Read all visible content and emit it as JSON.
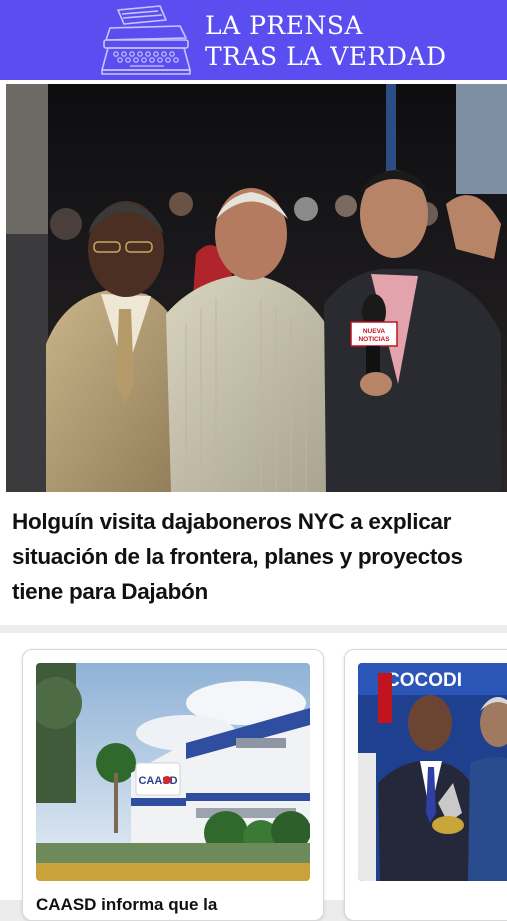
{
  "header": {
    "title_line1": "LA PRENSA",
    "title_line2": "TRAS LA VERDAD",
    "logo_icon": "typewriter-icon",
    "background": "#5a4ef0"
  },
  "hero": {
    "headline": "Holguín visita dajaboneros NYC a explicar situación de la frontera, planes y proyectos tiene para Dajabón",
    "mic_label": "NUEVA NOTICIAS"
  },
  "cards": [
    {
      "title": "CAASD informa que la",
      "sign_text": "CAASD"
    },
    {
      "title": "",
      "banner_text": "COCODI"
    }
  ]
}
